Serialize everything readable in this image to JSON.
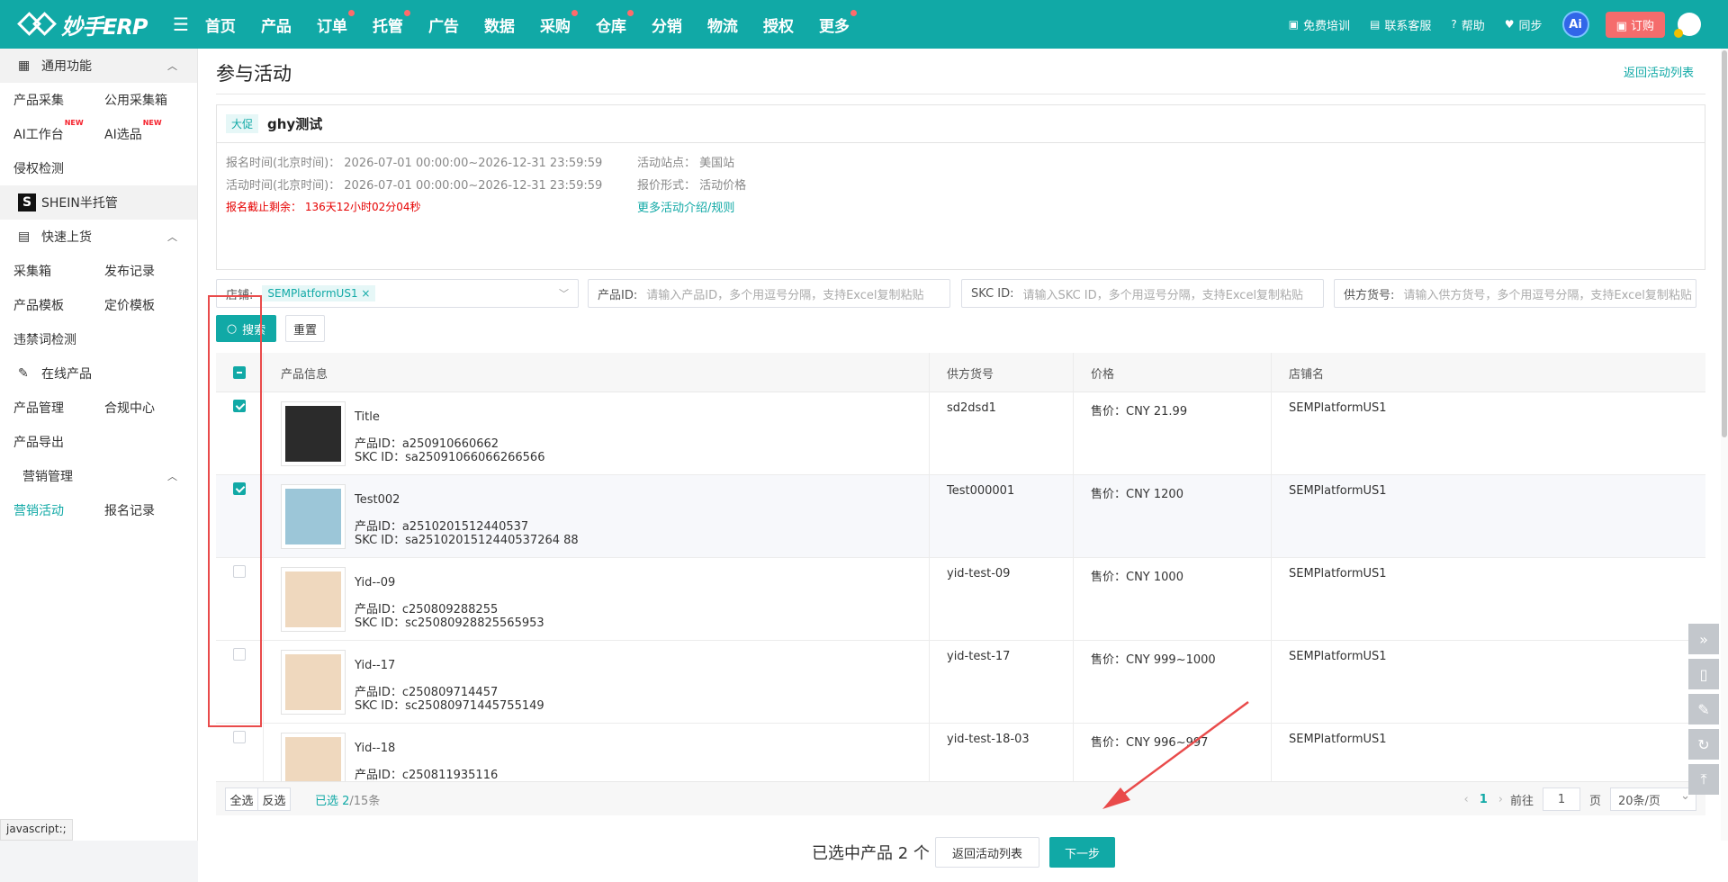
{
  "topbar": {
    "logo_text": "妙手ERP",
    "nav": [
      {
        "label": "首页",
        "dot": false
      },
      {
        "label": "产品",
        "dot": false
      },
      {
        "label": "订单",
        "dot": true
      },
      {
        "label": "托管",
        "dot": true
      },
      {
        "label": "广告",
        "dot": false
      },
      {
        "label": "数据",
        "dot": false
      },
      {
        "label": "采购",
        "dot": true
      },
      {
        "label": "仓库",
        "dot": true
      },
      {
        "label": "分销",
        "dot": false
      },
      {
        "label": "物流",
        "dot": false
      },
      {
        "label": "授权",
        "dot": false
      },
      {
        "label": "更多",
        "dot": true
      }
    ],
    "training": "免费培训",
    "service": "联系客服",
    "help": "帮助",
    "sync": "同步",
    "ai": "Ai",
    "order": "订购"
  },
  "sidebar": {
    "general": "通用功能",
    "general_items": [
      [
        "产品采集",
        "公用采集箱"
      ],
      [
        "AI工作台",
        "AI选品"
      ],
      [
        "侵权检测",
        ""
      ]
    ],
    "new_tag": "NEW",
    "shein": "SHEIN半托管",
    "shein_logo": "S",
    "quick": "快速上货",
    "quick_items": [
      [
        "采集箱",
        "发布记录"
      ],
      [
        "产品模板",
        "定价模板"
      ],
      [
        "违禁词检测",
        ""
      ]
    ],
    "online": "在线产品",
    "online_items": [
      [
        "产品管理",
        "合规中心"
      ],
      [
        "产品导出",
        ""
      ]
    ],
    "marketing": "营销管理",
    "marketing_items": [
      [
        "营销活动",
        "报名记录"
      ]
    ]
  },
  "status_text": "javascript:;",
  "page": {
    "title": "参与活动",
    "back_link": "返回活动列表"
  },
  "activity": {
    "tag": "大促",
    "name": "ghy测试",
    "signup_time": "报名时间(北京时间)：  2026-07-01 00:00:00~2026-12-31 23:59:59",
    "activity_time": "活动时间(北京时间)：  2026-07-01 00:00:00~2026-12-31 23:59:59",
    "countdown": "报名截止剩余：  136天12小时02分04秒",
    "site": "活动站点：  美国站",
    "price_form": "报价形式：  活动价格",
    "more_link": "更多活动介绍/规则"
  },
  "filters": {
    "store_label": "店铺:",
    "store_tag": "SEMPlatformUS1 ×",
    "product_id_label": "产品ID:",
    "product_id_ph": "请输入产品ID，多个用逗号分隔，支持Excel复制粘贴",
    "skc_label": "SKC ID:",
    "skc_ph": "请输入SKC ID，多个用逗号分隔，支持Excel复制粘贴",
    "supplier_label": "供方货号:",
    "supplier_ph": "请输入供方货号，多个用逗号分隔，支持Excel复制粘贴",
    "search_btn": "搜索",
    "reset_btn": "重置"
  },
  "table": {
    "headers": {
      "product": "产品信息",
      "supplier": "供方货号",
      "price": "价格",
      "store": "店铺名"
    },
    "rows": [
      {
        "title": "Title",
        "product_id": "产品ID：a250910660662",
        "skc_id": "SKC ID：sa25091066066266566",
        "supplier": "sd2dsd1",
        "price": "售价：CNY 21.99",
        "store": "SEMPlatformUS1",
        "checked": true,
        "thumb_color": "#2b2b2b"
      },
      {
        "title": "Test002",
        "product_id": "产品ID：a2510201512440537",
        "skc_id": "SKC ID：sa2510201512440537264 88",
        "supplier": "Test000001",
        "price": "售价：CNY 1200",
        "store": "SEMPlatformUS1",
        "checked": true,
        "thumb_color": "#9cc6d8"
      },
      {
        "title": "Yid--09",
        "product_id": "产品ID：c250809288255",
        "skc_id": "SKC ID：sc25080928825565953",
        "supplier": "yid-test-09",
        "price": "售价：CNY 1000",
        "store": "SEMPlatformUS1",
        "checked": false,
        "thumb_color": "#efd8be"
      },
      {
        "title": "Yid--17",
        "product_id": "产品ID：c250809714457",
        "skc_id": "SKC ID：sc25080971445755149",
        "supplier": "yid-test-17",
        "price": "售价：CNY 999~1000",
        "store": "SEMPlatformUS1",
        "checked": false,
        "thumb_color": "#efd8be"
      },
      {
        "title": "Yid--18",
        "product_id": "产品ID：c250811935116",
        "skc_id": "",
        "supplier": "yid-test-18-03",
        "price": "售价：CNY 996~997",
        "store": "SEMPlatformUS1",
        "checked": false,
        "thumb_color": "#efd8be"
      }
    ]
  },
  "footer": {
    "select_all": "全选",
    "invert": "反选",
    "selected_prefix": "已选 2",
    "selected_total": "/15条",
    "page_current": "1",
    "goto_label": "前往",
    "goto_value": "1",
    "page_unit": "页",
    "page_size": "20条/页"
  },
  "bottom": {
    "selected_text": "已选中产品 2 个",
    "back_btn": "返回活动列表",
    "next_btn": "下一步"
  },
  "colors": {
    "accent": "#11a9a6",
    "highlight_red": "#e94b4b"
  }
}
